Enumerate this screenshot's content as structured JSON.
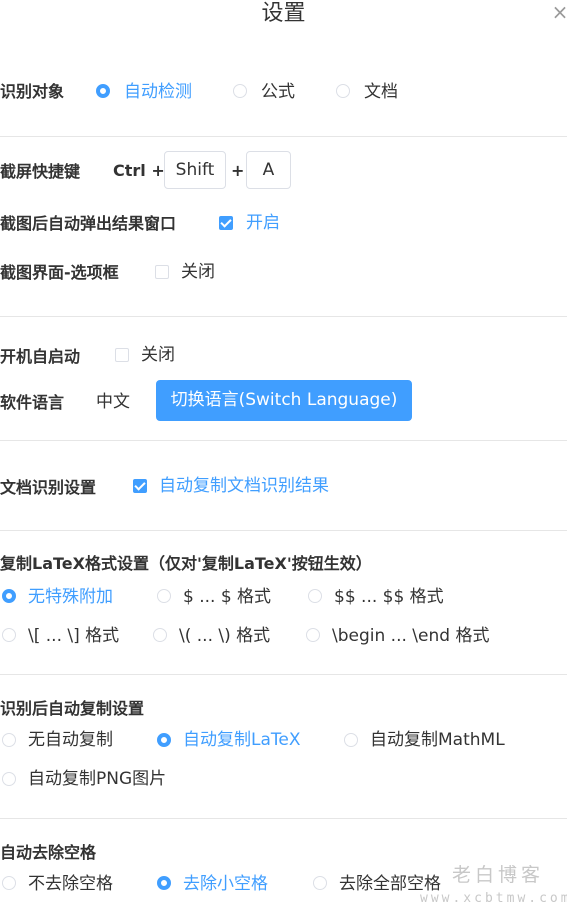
{
  "dialog": {
    "title": "设置",
    "close_glyph": "×"
  },
  "recognition_target": {
    "label": "识别对象",
    "options": [
      {
        "label": "自动检测",
        "selected": true
      },
      {
        "label": "公式",
        "selected": false
      },
      {
        "label": "文档",
        "selected": false
      }
    ]
  },
  "screenshot_hotkey": {
    "label": "截屏快捷键",
    "prefix": "Ctrl +",
    "key1": "Shift",
    "plus": "+",
    "key2": "A"
  },
  "auto_popup": {
    "label": "截图后自动弹出结果窗口",
    "checked": true,
    "state_label": "开启"
  },
  "screenshot_options_box": {
    "label": "截图界面-选项框",
    "checked": false,
    "state_label": "关闭"
  },
  "autostart": {
    "label": "开机自启动",
    "checked": false,
    "state_label": "关闭"
  },
  "language": {
    "label": "软件语言",
    "current": "中文",
    "switch_button": "切换语言(Switch Language)"
  },
  "doc_recognition": {
    "label": "文档识别设置",
    "checked": true,
    "option_label": "自动复制文档识别结果"
  },
  "latex_format": {
    "label": "复制LaTeX格式设置（仅对'复制LaTeX'按钮生效）",
    "options": [
      {
        "label": "无特殊附加",
        "selected": true
      },
      {
        "label": "$ ... $ 格式",
        "selected": false
      },
      {
        "label": "$$ ... $$ 格式",
        "selected": false
      },
      {
        "label": "\\[ ... \\] 格式",
        "selected": false
      },
      {
        "label": "\\( ... \\) 格式",
        "selected": false
      },
      {
        "label": "\\begin ... \\end 格式",
        "selected": false
      }
    ]
  },
  "auto_copy": {
    "label": "识别后自动复制设置",
    "options": [
      {
        "label": "无自动复制",
        "selected": false
      },
      {
        "label": "自动复制LaTeX",
        "selected": true
      },
      {
        "label": "自动复制MathML",
        "selected": false
      },
      {
        "label": "自动复制PNG图片",
        "selected": false
      }
    ]
  },
  "remove_spaces": {
    "label": "自动去除空格",
    "options": [
      {
        "label": "不去除空格",
        "selected": false
      },
      {
        "label": "去除小空格",
        "selected": true
      },
      {
        "label": "去除全部空格",
        "selected": false
      }
    ]
  },
  "watermark": {
    "line1": "老白博客",
    "line2": "www.xcbtmw.com"
  },
  "colors": {
    "accent": "#409eff",
    "text": "#333333",
    "border": "#dcdfe6",
    "divider": "#e6e6e6"
  }
}
